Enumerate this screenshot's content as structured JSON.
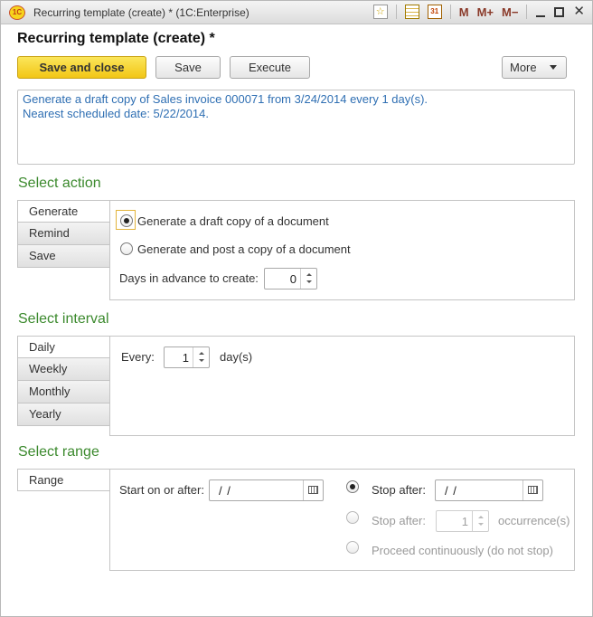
{
  "window": {
    "title": "Recurring template (create) * (1C:Enterprise)",
    "logo": "1С"
  },
  "titlebar_icons": {
    "favorite": "☆",
    "calendar_day": "31",
    "m": "M",
    "m_plus": "M+",
    "m_minus": "M−",
    "close": "✕"
  },
  "form": {
    "title": "Recurring template (create) *"
  },
  "toolbar": {
    "save_close": "Save and close",
    "save": "Save",
    "execute": "Execute",
    "more": "More"
  },
  "description": {
    "line1": "Generate a draft copy of Sales invoice 000071 from 3/24/2014 every 1 day(s).",
    "line2": "Nearest scheduled date: 5/22/2014."
  },
  "select_action": {
    "title": "Select action",
    "tabs": [
      "Generate",
      "Remind",
      "Save"
    ],
    "active_tab": "Generate",
    "option_generate_draft": "Generate a draft copy of a document",
    "option_generate_post": "Generate and post a copy of a document",
    "selected_option": "Generate a draft copy of a document",
    "days_advance_label": "Days in advance to create:",
    "days_advance_value": "0"
  },
  "select_interval": {
    "title": "Select interval",
    "tabs": [
      "Daily",
      "Weekly",
      "Monthly",
      "Yearly"
    ],
    "active_tab": "Daily",
    "every_label": "Every:",
    "every_value": "1",
    "unit": "day(s)"
  },
  "select_range": {
    "title": "Select range",
    "tabs": [
      "Range"
    ],
    "active_tab": "Range",
    "start_label": "Start on or after:",
    "start_value": "/ /",
    "stop_after_date_label": "Stop after:",
    "stop_after_date_value": "/ /",
    "stop_after_count_label": "Stop after:",
    "stop_after_count_value": "1",
    "occurrences_label": "occurrence(s)",
    "proceed_label": "Proceed continuously (do not stop)",
    "selected_option": "Stop after date"
  },
  "colors": {
    "section_title": "#3c8a2e",
    "description_text": "#2f6fb3",
    "primary_button": "#f2c616"
  }
}
